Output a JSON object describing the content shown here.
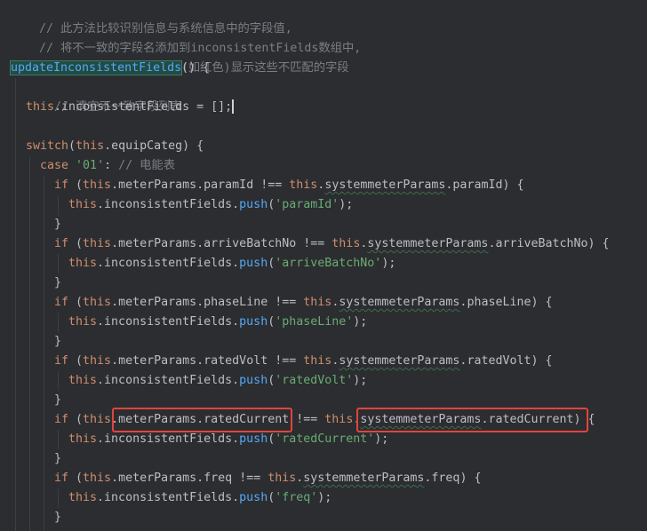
{
  "code": {
    "comment1": "// 此方法比较识别信息与系统信息中的字段值,",
    "comment2": "// 将不一致的字段名添加到inconsistentFields数组中,",
    "comment3": "// 用于在UI中以特殊样式(如红色)显示这些不匹配的字段",
    "method_name": "updateInconsistentFields",
    "clear_comment": "// 清空不一致字段列表",
    "this": "this",
    "inconsistent_fields": "inconsistentFields",
    "switch_kw": "switch",
    "equip_categ": "equipCateg",
    "case_kw": "case",
    "case_value": "'01'",
    "case_comment": "// 电能表",
    "if_kw": "if",
    "meter_params": "meterParams",
    "system_meter_params": "systemmeterParams",
    "push": "push",
    "neq": "!==",
    "fields": [
      {
        "prop": "paramId",
        "str": "'paramId'"
      },
      {
        "prop": "arriveBatchNo",
        "str": "'arriveBatchNo'"
      },
      {
        "prop": "phaseLine",
        "str": "'phaseLine'"
      },
      {
        "prop": "ratedVolt",
        "str": "'ratedVolt'"
      },
      {
        "prop": "ratedCurrent",
        "str": "'ratedCurrent'"
      },
      {
        "prop": "freq",
        "str": "'freq'"
      }
    ]
  },
  "colors": {
    "background": "#2b2d30",
    "keyword": "#cf8e6d",
    "string": "#6aab73",
    "comment": "#7a7e85",
    "function": "#56a8f5",
    "highlight_box": "#e0443e"
  }
}
